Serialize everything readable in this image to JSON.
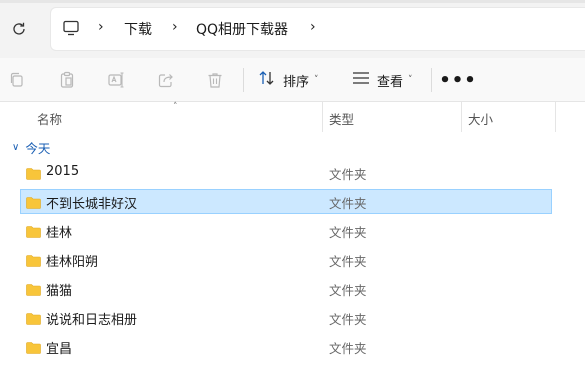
{
  "address": {
    "breadcrumbs": [
      "下载",
      "QQ相册下载器"
    ]
  },
  "toolbar": {
    "sort_label": "排序",
    "view_label": "查看",
    "more_label": "•••"
  },
  "columns": {
    "name": "名称",
    "type": "类型",
    "size": "大小"
  },
  "group": {
    "label": "今天"
  },
  "files": [
    {
      "name": "2015",
      "type": "文件夹"
    },
    {
      "name": "不到长城非好汉",
      "type": "文件夹",
      "selected": true
    },
    {
      "name": "桂林",
      "type": "文件夹"
    },
    {
      "name": "桂林阳朔",
      "type": "文件夹"
    },
    {
      "name": "猫猫",
      "type": "文件夹"
    },
    {
      "name": "说说和日志相册",
      "type": "文件夹"
    },
    {
      "name": "宜昌",
      "type": "文件夹"
    }
  ],
  "colors": {
    "selection_bg": "#cce8ff",
    "selection_border": "#99d1ff",
    "folder_yellow": "#f8c53a",
    "group_blue": "#1a5fb4"
  },
  "icons": [
    "refresh-icon",
    "this-pc-icon",
    "copy-icon",
    "paste-icon",
    "rename-icon",
    "share-icon",
    "delete-icon",
    "sort-icon",
    "view-icon",
    "folder-icon"
  ]
}
